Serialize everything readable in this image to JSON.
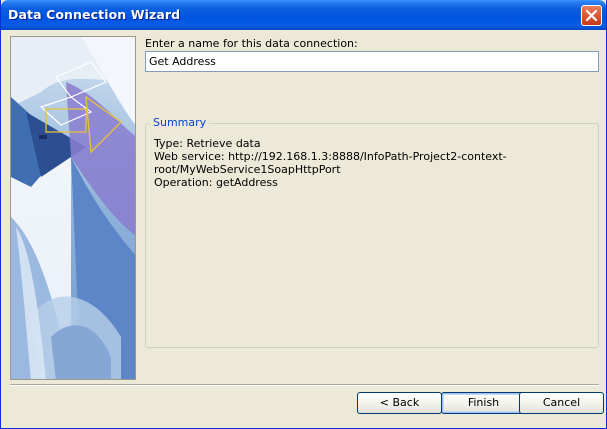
{
  "window": {
    "title": "Data Connection Wizard",
    "close_icon": "close-icon"
  },
  "form": {
    "prompt_label": "Enter a name for this data connection:",
    "name_value": "Get Address"
  },
  "summary": {
    "legend": "Summary",
    "lines": [
      "Type: Retrieve data",
      "Web service: http://192.168.1.3:8888/InfoPath-Project2-context-",
      "root/MyWebService1SoapHttpPort",
      "Operation: getAddress"
    ]
  },
  "buttons": {
    "back": "< Back",
    "finish": "Finish",
    "cancel": "Cancel"
  },
  "colors": {
    "titlebar": "#0054e3",
    "dialog_bg": "#ece9d8",
    "summary_legend": "#0046d5"
  }
}
